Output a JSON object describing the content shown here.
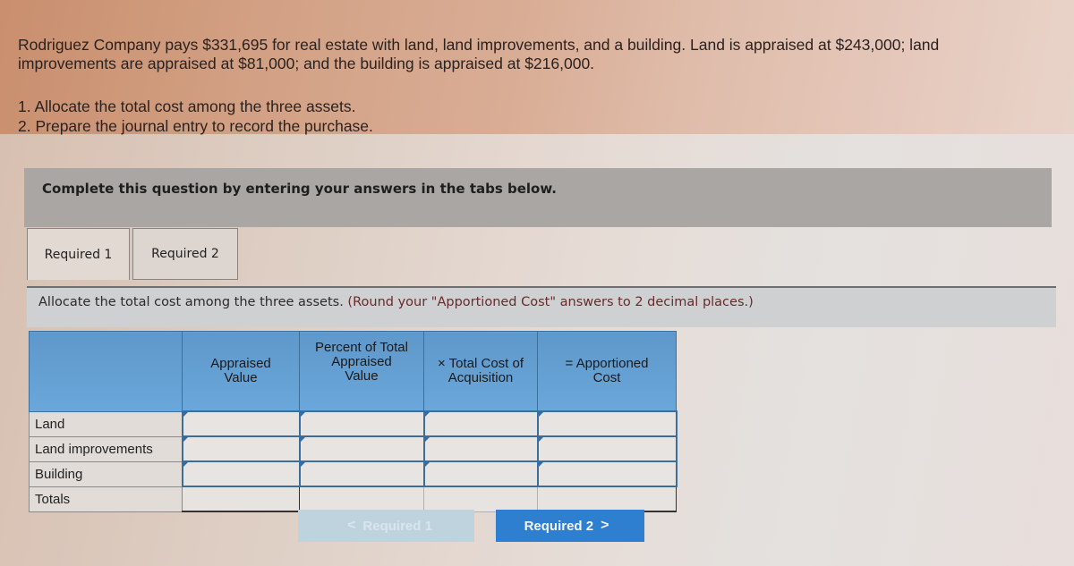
{
  "problem": {
    "line1": "Rodriguez Company pays $331,695 for real estate with land, land improvements, and a building. Land is appraised at $243,000; land",
    "line2": "improvements are appraised at $81,000; and the building is appraised at $216,000."
  },
  "tasks": [
    "1. Allocate the total cost among the three assets.",
    "2. Prepare the journal entry to record the purchase."
  ],
  "instruction": "Complete this question by entering your answers in the tabs below.",
  "tabs": [
    {
      "label": "Required 1",
      "active": true
    },
    {
      "label": "Required 2",
      "active": false
    }
  ],
  "prompt": {
    "text": "Allocate the total cost among the three assets.",
    "note": "(Round your \"Apportioned Cost\" answers to 2 decimal places.)"
  },
  "table": {
    "headers": [
      "",
      "Appraised Value",
      "Percent of Total Appraised Value",
      "× Total Cost of Acquisition",
      "= Apportioned Cost"
    ],
    "header_lines": [
      [],
      [
        "Appraised",
        "Value"
      ],
      [
        "Percent of Total",
        "Appraised",
        "Value"
      ],
      [
        "× Total Cost of",
        "Acquisition"
      ],
      [
        "= Apportioned",
        "Cost"
      ]
    ],
    "rows": [
      {
        "label": "Land",
        "values": [
          "",
          "",
          "",
          ""
        ]
      },
      {
        "label": "Land improvements",
        "values": [
          "",
          "",
          "",
          ""
        ]
      },
      {
        "label": "Building",
        "values": [
          "",
          "",
          "",
          ""
        ]
      },
      {
        "label": "Totals",
        "values": [
          "",
          "",
          "",
          ""
        ]
      }
    ]
  },
  "nav": {
    "prev_label": "Required 1",
    "prev_icon": "chevron-left-icon",
    "prev_glyph": "<",
    "next_label": "Required 2",
    "next_icon": "chevron-right-icon",
    "next_glyph": ">"
  },
  "colors": {
    "header_blue": "#5f98cb",
    "next_button": "#2f7fd0",
    "prev_button_disabled": "#bfd3df",
    "instruction_bar": "#a9a6a3"
  }
}
